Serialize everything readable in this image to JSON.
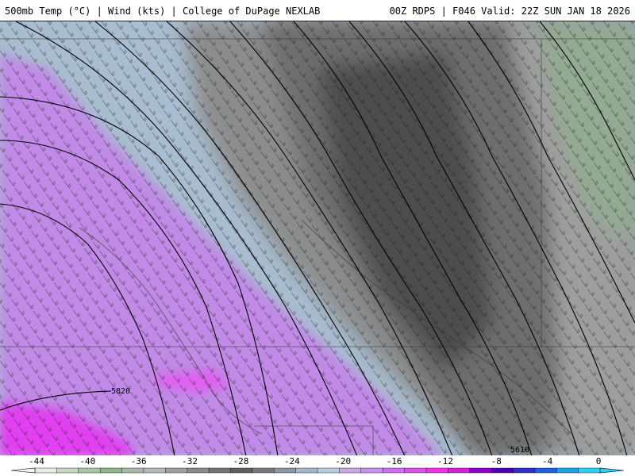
{
  "header": {
    "left_title": "500mb Temp (°C) | Wind (kts) | College of DuPage NEXLAB",
    "right_title": "00Z RDPS | F046 Valid: 22Z SUN JAN 18 2026"
  },
  "map": {
    "contour_labels": [
      "5820",
      "5610"
    ]
  },
  "colorbar": {
    "ticks": [
      "-44",
      "-40",
      "-36",
      "-32",
      "-28",
      "-24",
      "-20",
      "-16",
      "-12",
      "-8",
      "-4",
      "0"
    ],
    "colors": [
      "#e8ece6",
      "#c7d8c3",
      "#a9c7a3",
      "#8fb58a",
      "#a8b8aa",
      "#b5b8b6",
      "#a0a0a0",
      "#8a8a8a",
      "#747474",
      "#606060",
      "#767a80",
      "#8d97a3",
      "#a3b6cc",
      "#b8cde0",
      "#c8a8e8",
      "#c890f0",
      "#d070f0",
      "#e050f0",
      "#f030f0",
      "#d020e0",
      "#9000c8",
      "#5000b0",
      "#3030c0",
      "#2060d8",
      "#20a0e8",
      "#30d0f0"
    ]
  }
}
